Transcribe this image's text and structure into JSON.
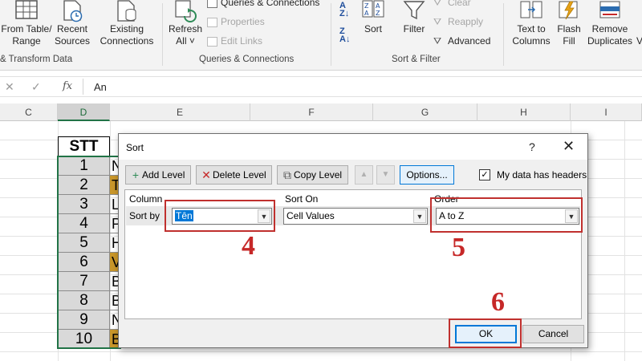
{
  "ribbon": {
    "buttons": [
      {
        "label": "From Table/\nRange",
        "icon": "table-icon"
      },
      {
        "label": "Recent\nSources",
        "icon": "recent-sources-icon"
      },
      {
        "label": "Existing\nConnections",
        "icon": "existing-connections-icon"
      },
      {
        "label": "Refresh\nAll ˅",
        "icon": "refresh-icon"
      },
      {
        "label": "Sort",
        "icon": "sort-icon"
      },
      {
        "label": "Filter",
        "icon": "filter-icon"
      },
      {
        "label": "Text to\nColumns",
        "icon": "text-to-columns-icon"
      },
      {
        "label": "Flash\nFill",
        "icon": "flash-fill-icon"
      },
      {
        "label": "Remove\nDuplicates",
        "icon": "remove-duplicates-icon"
      },
      {
        "label": "V",
        "icon": ""
      }
    ],
    "small_items": {
      "queries_connections": "Queries & Connections",
      "properties": "Properties",
      "edit_links": "Edit Links",
      "clear": "Clear",
      "reapply": "Reapply",
      "advanced": "Advanced"
    },
    "groups": {
      "transform": "& Transform Data",
      "queries": "Queries & Connections",
      "sort_filter": "Sort & Filter"
    }
  },
  "formula_bar": {
    "cancel": "✕",
    "enter": "✓",
    "fx": "fx",
    "value": "An"
  },
  "sheet": {
    "columns": [
      "C",
      "D",
      "E",
      "F",
      "G",
      "H",
      "I"
    ],
    "selected_column": "D",
    "header_cell": "STT",
    "rows": [
      "1",
      "2",
      "3",
      "4",
      "5",
      "6",
      "7",
      "8",
      "9",
      "10"
    ],
    "e_col_letters": [
      "N",
      "T",
      "L",
      "P",
      "H",
      "V",
      "B",
      "B",
      "N",
      "B"
    ],
    "e_col_highlighted": [
      false,
      true,
      false,
      false,
      false,
      true,
      false,
      false,
      false,
      true
    ]
  },
  "dialog": {
    "title": "Sort",
    "help": "?",
    "close": "✕",
    "add_level": "Add Level",
    "delete_level": "Delete Level",
    "copy_level": "Copy Level",
    "options": "Options...",
    "my_data_has_headers": "My data has headers",
    "headers_checked": true,
    "column_header": "Column",
    "sort_on_header": "Sort On",
    "order_header": "Order",
    "sort_by_label": "Sort by",
    "column_value": "Tên",
    "sort_on_value": "Cell Values",
    "order_value": "A to Z",
    "ok": "OK",
    "cancel": "Cancel"
  },
  "annotations": {
    "step4": "4",
    "step5": "5",
    "step6": "6",
    "color": "#c62828"
  },
  "colors": {
    "excel_green": "#217346",
    "ribbon_bg": "#f3f3f3",
    "highlight_gold": "#c8962a",
    "focus_blue": "#0078d7"
  }
}
